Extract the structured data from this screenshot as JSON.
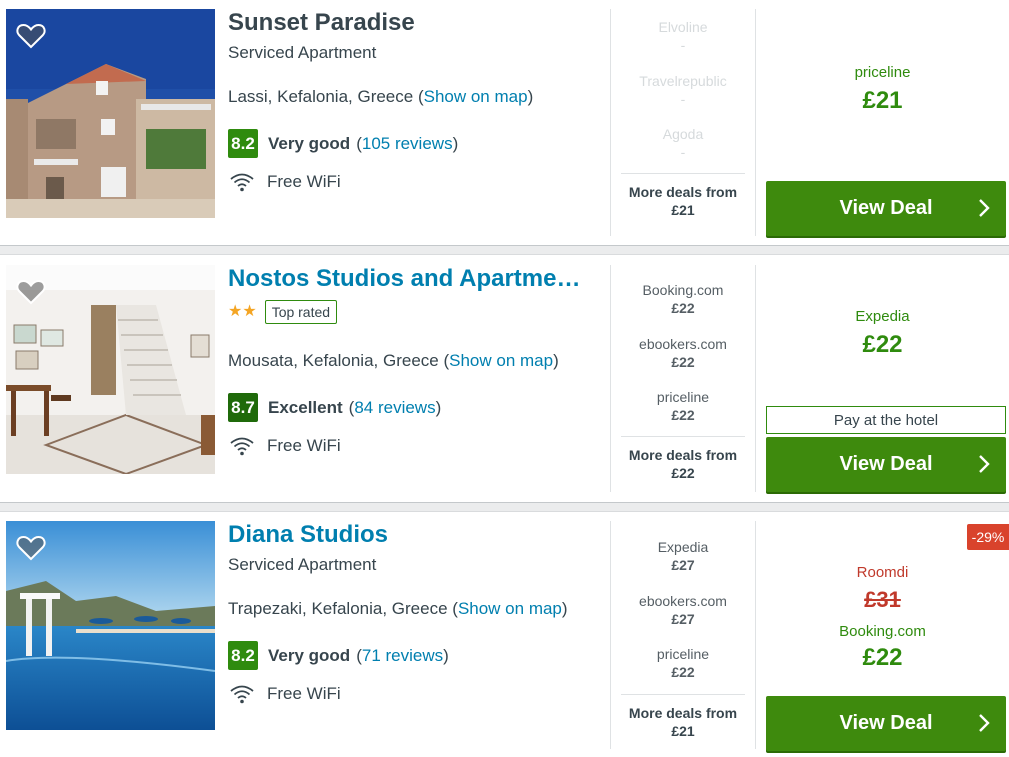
{
  "colors": {
    "accent_green": "#2f8b0e",
    "button_green": "#3e8a0d",
    "link_blue": "#007faf",
    "discount_red": "#d9432c",
    "text": "#37454d"
  },
  "icons": {
    "favorite": "heart-icon",
    "wifi": "wifi-icon",
    "chevron": "chevron-right-icon",
    "star": "star-icon"
  },
  "hotels": [
    {
      "name": "Sunset Paradise",
      "type": "Serviced Apartment",
      "location": "Lassi, Kefalonia, Greece",
      "map_link": "Show on map",
      "score": "8.2",
      "rating_word": "Very good",
      "reviews": "105 reviews",
      "amenity": "Free WiFi",
      "deals": [
        {
          "name": "Elvoline",
          "price": "-"
        },
        {
          "name": "Travelrepublic",
          "price": "-"
        },
        {
          "name": "Agoda",
          "price": "-"
        }
      ],
      "more_label": "More deals from",
      "more_price": "£21",
      "best_provider": "priceline",
      "best_price": "£21",
      "button": "View Deal"
    },
    {
      "name": "Nostos Studios and Apartme…",
      "stars": 2,
      "badge": "Top rated",
      "location": "Mousata, Kefalonia, Greece",
      "map_link": "Show on map",
      "score": "8.7",
      "rating_word": "Excellent",
      "reviews": "84 reviews",
      "amenity": "Free WiFi",
      "deals": [
        {
          "name": "Booking.com",
          "price": "£22"
        },
        {
          "name": "ebookers.com",
          "price": "£22"
        },
        {
          "name": "priceline",
          "price": "£22"
        }
      ],
      "more_label": "More deals from",
      "more_price": "£22",
      "best_provider": "Expedia",
      "best_price": "£22",
      "pay_at_hotel": "Pay at the hotel",
      "button": "View Deal"
    },
    {
      "name": "Diana Studios",
      "type": "Serviced Apartment",
      "location": "Trapezaki, Kefalonia, Greece",
      "map_link": "Show on map",
      "score": "8.2",
      "rating_word": "Very good",
      "reviews": "71 reviews",
      "amenity": "Free WiFi",
      "deals": [
        {
          "name": "Expedia",
          "price": "£27"
        },
        {
          "name": "ebookers.com",
          "price": "£27"
        },
        {
          "name": "priceline",
          "price": "£22"
        }
      ],
      "more_label": "More deals from",
      "more_price": "£21",
      "discount": "-29%",
      "old_provider": "Roomdi",
      "old_price": "£31",
      "best_provider": "Booking.com",
      "best_price": "£22",
      "button": "View Deal"
    }
  ]
}
